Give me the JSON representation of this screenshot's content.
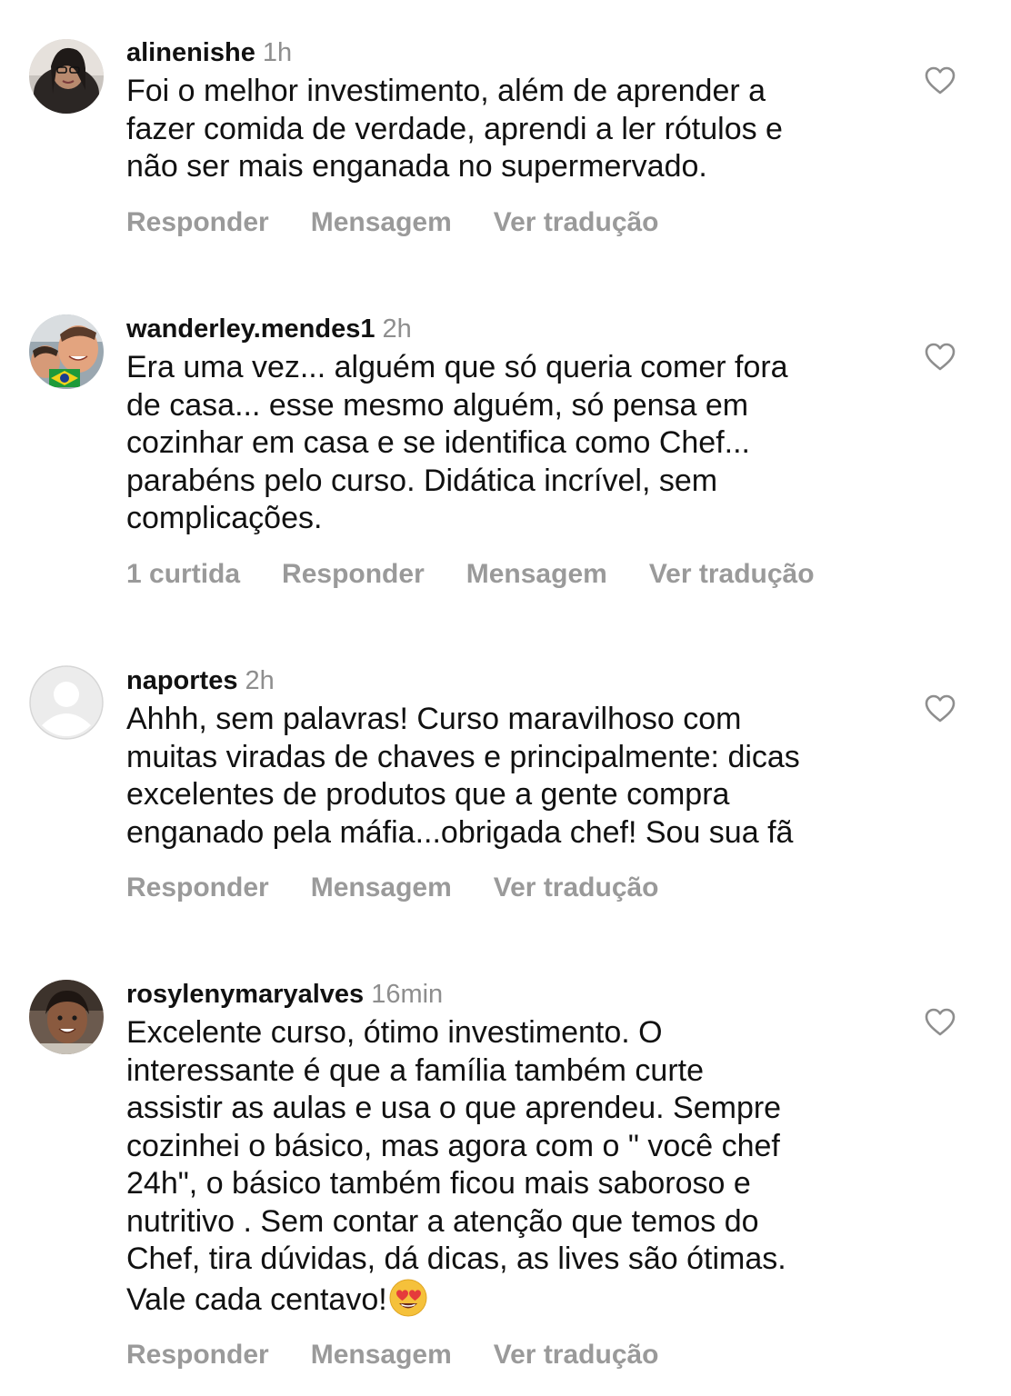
{
  "comments": [
    {
      "username": "alinenishe",
      "time": "1h",
      "text": "Foi o melhor investimento, além de aprender a\nfazer comida de verdade, aprendi a ler rótulos e\nnão ser mais enganada no supermervado.",
      "likes": "",
      "reply": "Responder",
      "message": "Mensagem",
      "translate": "Ver tradução"
    },
    {
      "username": "wanderley.mendes1",
      "time": "2h",
      "text": "Era uma vez... alguém que só queria comer fora\nde casa... esse mesmo alguém, só pensa em\ncozinhar em casa e se identifica como Chef...\nparabéns pelo curso. Didática incrível, sem\ncomplicações.",
      "likes": "1 curtida",
      "reply": "Responder",
      "message": "Mensagem",
      "translate": "Ver tradução"
    },
    {
      "username": "naportes",
      "time": "2h",
      "text": "Ahhh, sem palavras! Curso maravilhoso com\nmuitas viradas de chaves e principalmente: dicas\nexcelentes de produtos que a gente compra\nenganado pela máfia...obrigada chef! Sou sua fã",
      "likes": "",
      "reply": "Responder",
      "message": "Mensagem",
      "translate": "Ver tradução"
    },
    {
      "username": "rosylenymaryalves",
      "time": "16min",
      "text": "Excelente curso, ótimo investimento.  O\ninteressante é que a família também curte\nassistir as aulas e usa o que aprendeu.  Sempre\ncozinhei o básico,  mas agora com o \" você chef\n24h\", o básico também ficou mais saboroso e\nnutritivo . Sem contar  a atenção que temos do\nChef, tira dúvidas,  dá dicas, as lives são ótimas.\nVale cada centavo!",
      "emoji": "heart-eyes-emoji",
      "likes": "",
      "reply": "Responder",
      "message": "Mensagem",
      "translate": "Ver tradução"
    }
  ],
  "icons": {
    "like": "heart-outline-icon",
    "avatar_placeholder": "default-user-icon"
  },
  "colors": {
    "text": "#111111",
    "muted": "#8e8e8e",
    "actions": "#9a9a9a",
    "heart_stroke": "#8e8e8e"
  }
}
